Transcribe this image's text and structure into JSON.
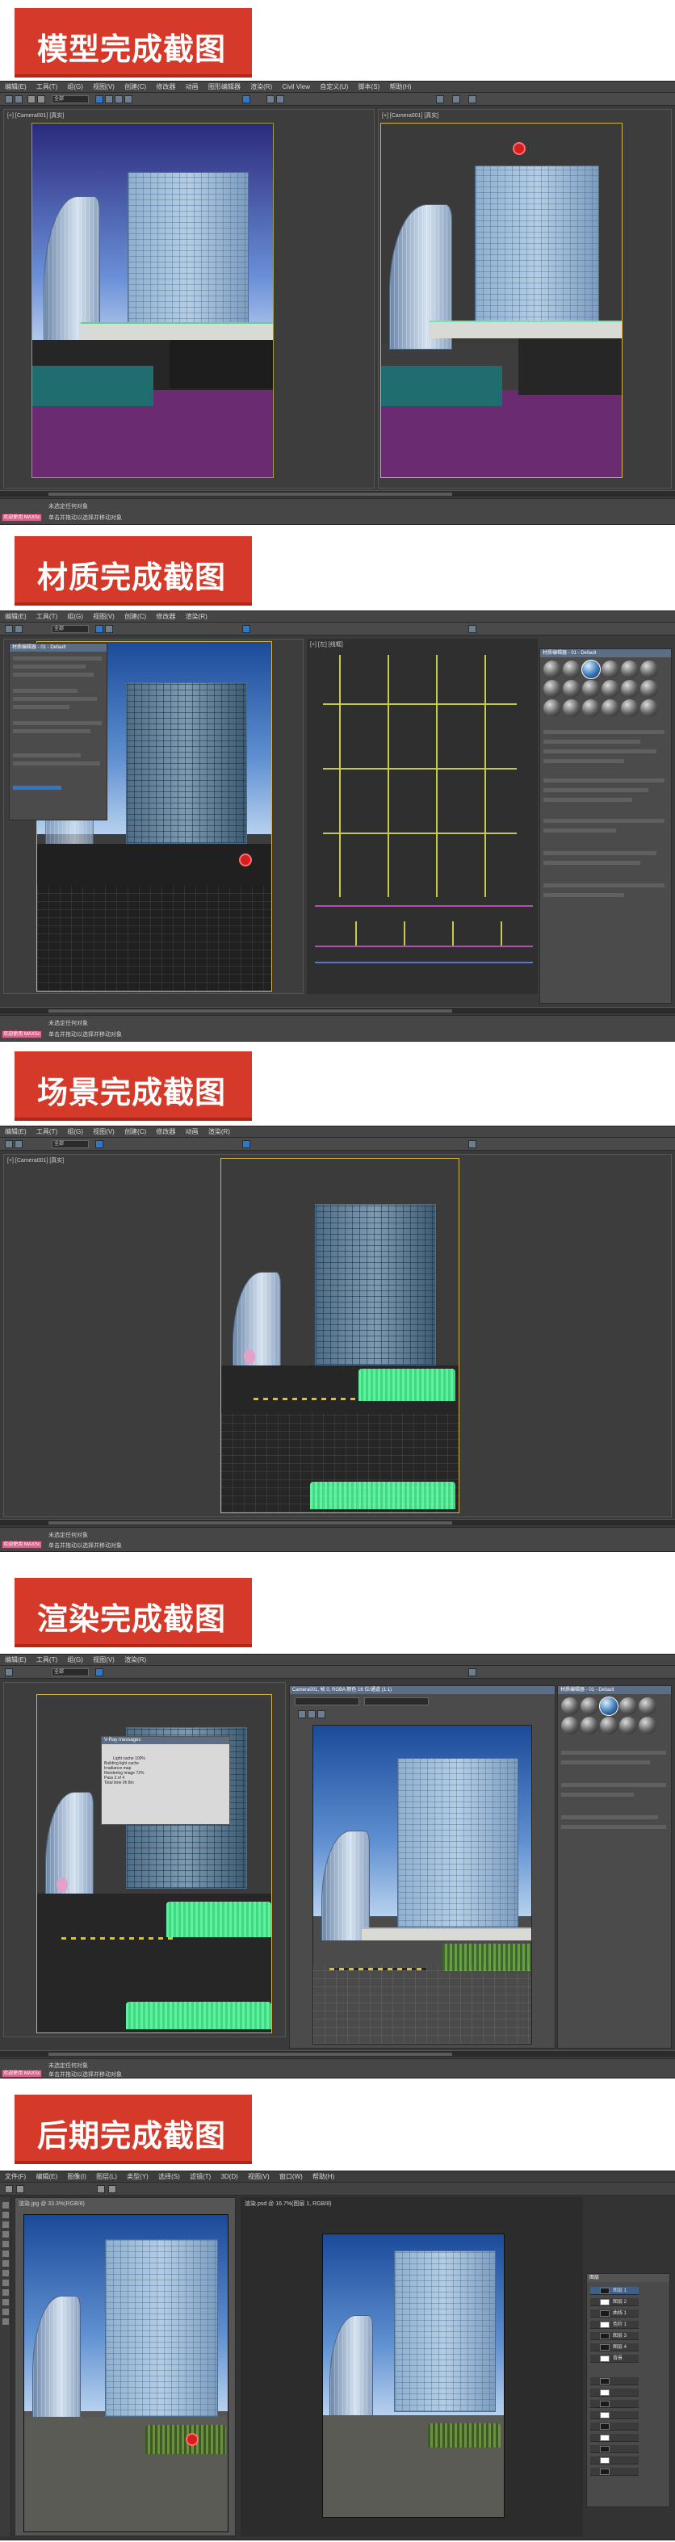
{
  "sections": [
    {
      "id": "model",
      "title": "模型完成截图"
    },
    {
      "id": "material",
      "title": "材质完成截图"
    },
    {
      "id": "scene",
      "title": "场景完成截图"
    },
    {
      "id": "render",
      "title": "渲染完成截图"
    },
    {
      "id": "post",
      "title": "后期完成截图"
    }
  ],
  "max": {
    "menu": [
      "编辑(E)",
      "工具(T)",
      "组(G)",
      "视图(V)",
      "创建(C)",
      "修改器",
      "动画",
      "图形编辑器",
      "渲染(R)",
      "Civil View",
      "自定义(U)",
      "脚本(S)",
      "帮助(H)"
    ],
    "view_all": "全部",
    "viewport_camera": "[+] [Camera001] [真实]",
    "viewport_left": "[+] [左] [线框]",
    "status_badge": "欢迎使用 MAXSc",
    "status_lines": [
      "未选定任何对象",
      "单击并拖动以选择并移动对象"
    ],
    "material_editor_title": "材质编辑器 - 01 - Default",
    "render_window_title": "Camera001, 帧 0, RGBA 颜色 16 位/通道 (1:1)",
    "stats_title": "V-Ray messages",
    "stats_text": "Light cache 100%\nBuilding light cache\nIrradiance map\nRendering image 72%\nPass 3 of 4\nTotal time 0h 8m"
  },
  "ps": {
    "menu": [
      "文件(F)",
      "编辑(E)",
      "图像(I)",
      "图层(L)",
      "类型(Y)",
      "选择(S)",
      "滤镜(T)",
      "3D(D)",
      "视图(V)",
      "窗口(W)",
      "帮助(H)"
    ],
    "tab1": "渲染.jpg @ 33.3%(RGB/8)",
    "tab2": "渲染.psd @ 16.7%(图层 1, RGB/8)",
    "layers_title": "图层",
    "layer_names": [
      "图层 1",
      "图层 2",
      "曲线 1",
      "色阶 1",
      "图层 3",
      "图层 4",
      "背景"
    ]
  }
}
